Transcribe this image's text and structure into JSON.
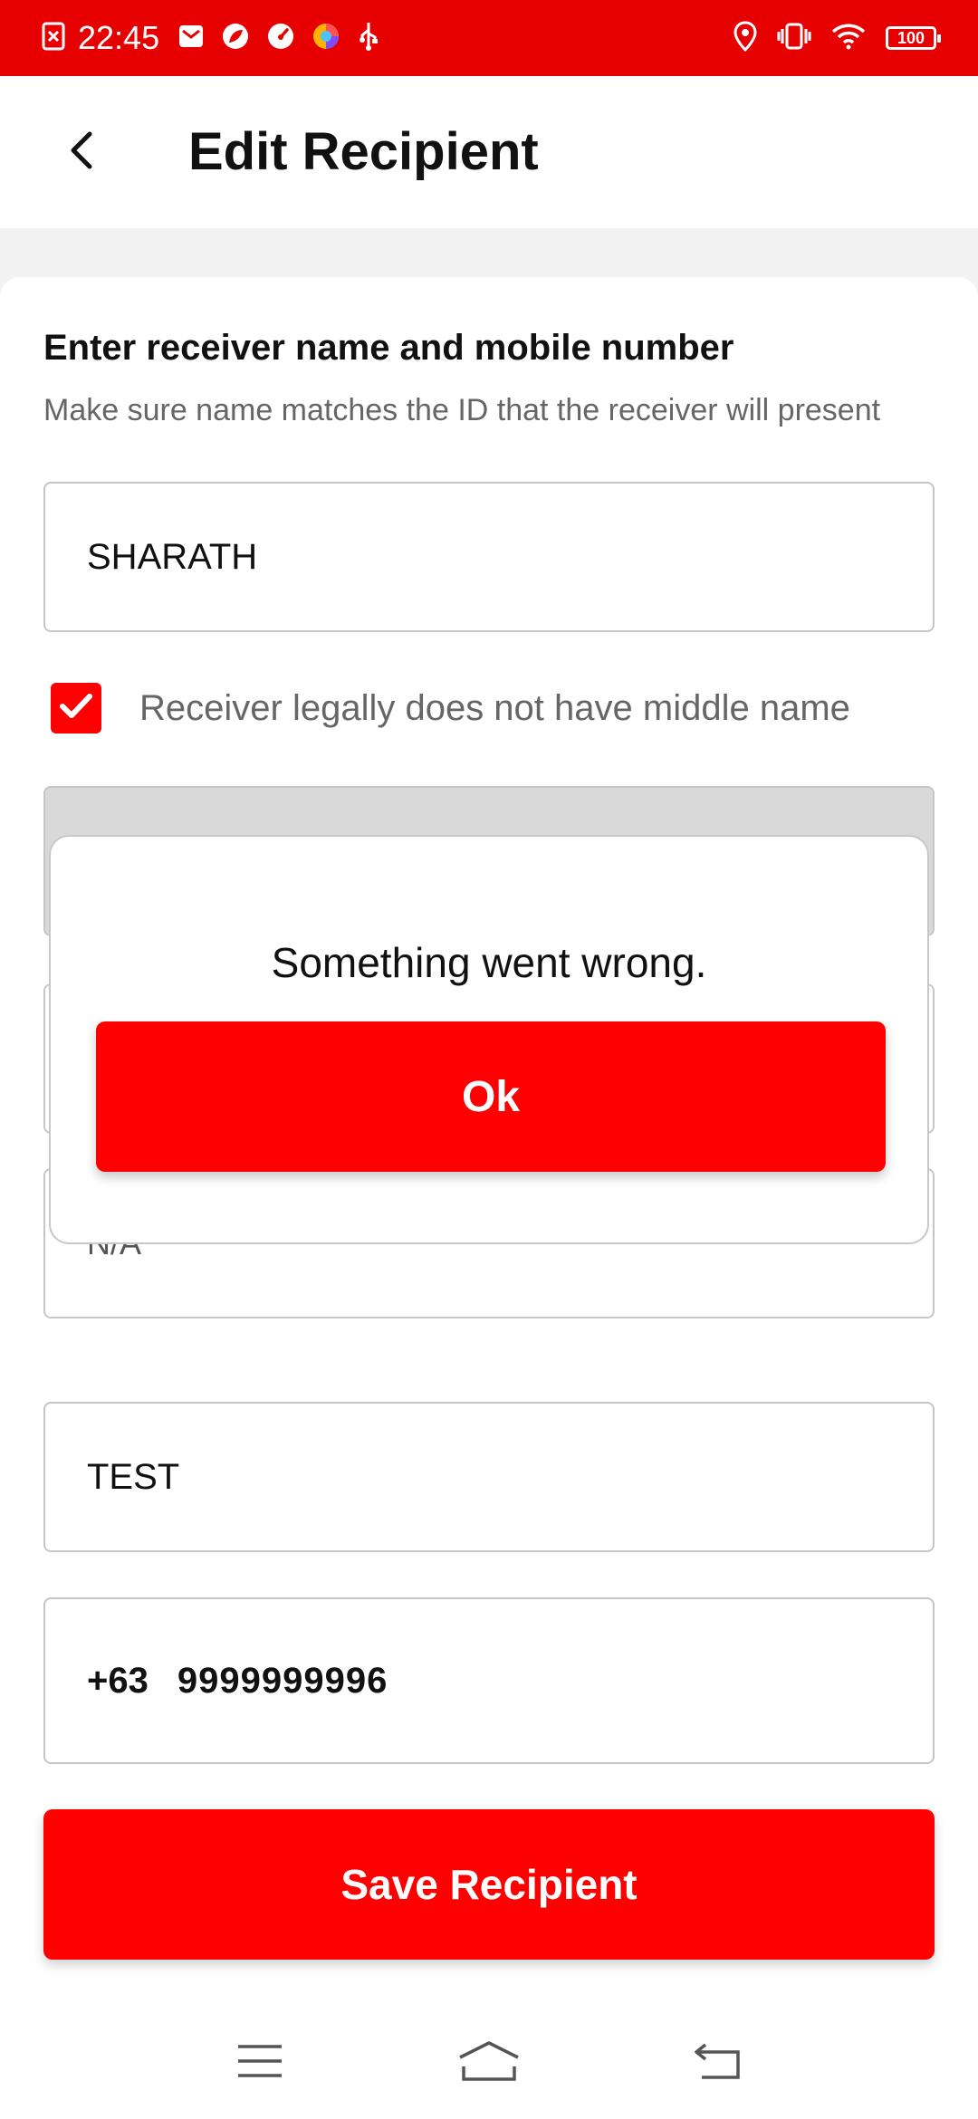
{
  "status_bar": {
    "time": "22:45",
    "battery": "100",
    "left_icons": [
      "screenshot-icon",
      "mail-icon",
      "leaf-icon",
      "speedometer-icon",
      "browser-icon",
      "usb-icon"
    ],
    "right_icons": [
      "location-icon",
      "vibrate-icon",
      "wifi-icon",
      "battery-icon"
    ]
  },
  "header": {
    "title": "Edit Recipient",
    "back_icon": "chevron-left-icon"
  },
  "form": {
    "section_title": "Enter receiver name and mobile number",
    "section_subtitle": "Make sure name matches the ID that the receiver will present",
    "first_name": "SHARATH",
    "no_middle_name_checked": true,
    "no_middle_name_label": "Receiver legally does not have middle name",
    "middle_name_placeholder": "N/A",
    "last_name": "TEST",
    "country_code": "+63",
    "mobile_number": "9999999996",
    "save_label": "Save Recipient"
  },
  "dialog": {
    "message": "Something went wrong.",
    "ok_label": "Ok"
  },
  "nav_bar": {
    "icons": [
      "menu-icon",
      "home-icon",
      "back-icon"
    ]
  },
  "colors": {
    "accent": "#ff0000",
    "status_bar": "#e60000",
    "disabled_field": "#d9d9d9"
  }
}
